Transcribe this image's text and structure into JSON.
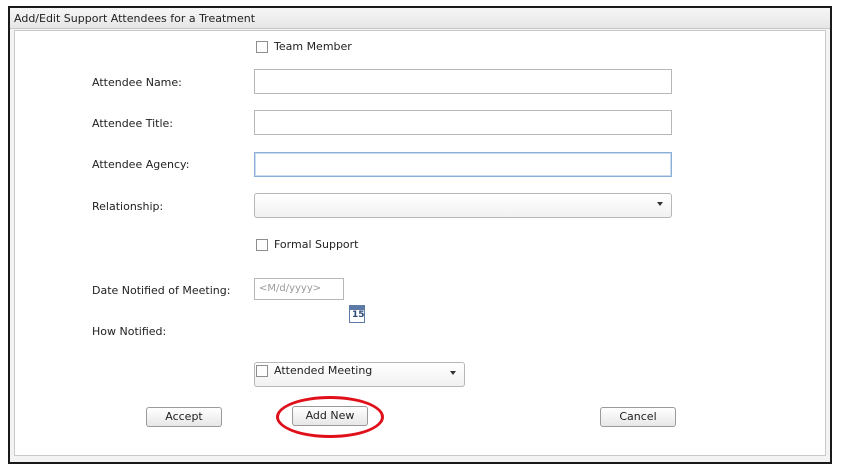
{
  "dialog": {
    "title": "Add/Edit Support Attendees for a Treatment"
  },
  "form": {
    "team_member_label": "Team Member",
    "attendee_name_label": "Attendee Name:",
    "attendee_name_value": "",
    "attendee_title_label": "Attendee Title:",
    "attendee_title_value": "",
    "attendee_agency_label": "Attendee Agency:",
    "attendee_agency_value": "",
    "relationship_label": "Relationship:",
    "relationship_value": "",
    "formal_support_label": "Formal Support",
    "date_notified_label": "Date Notified of Meeting:",
    "date_notified_placeholder": "<M/d/yyyy>",
    "calendar_day": "15",
    "how_notified_label": "How Notified:",
    "how_notified_value": "",
    "attended_meeting_label": "Attended Meeting"
  },
  "buttons": {
    "accept": "Accept",
    "add_new": "Add New",
    "cancel": "Cancel"
  },
  "annotation": {
    "highlight_color": "#e0101a"
  },
  "colors": {
    "dialog_border": "#1a1a1a",
    "field_focus": "#8bb0d8",
    "calendar_blue": "#5c7aa6"
  }
}
